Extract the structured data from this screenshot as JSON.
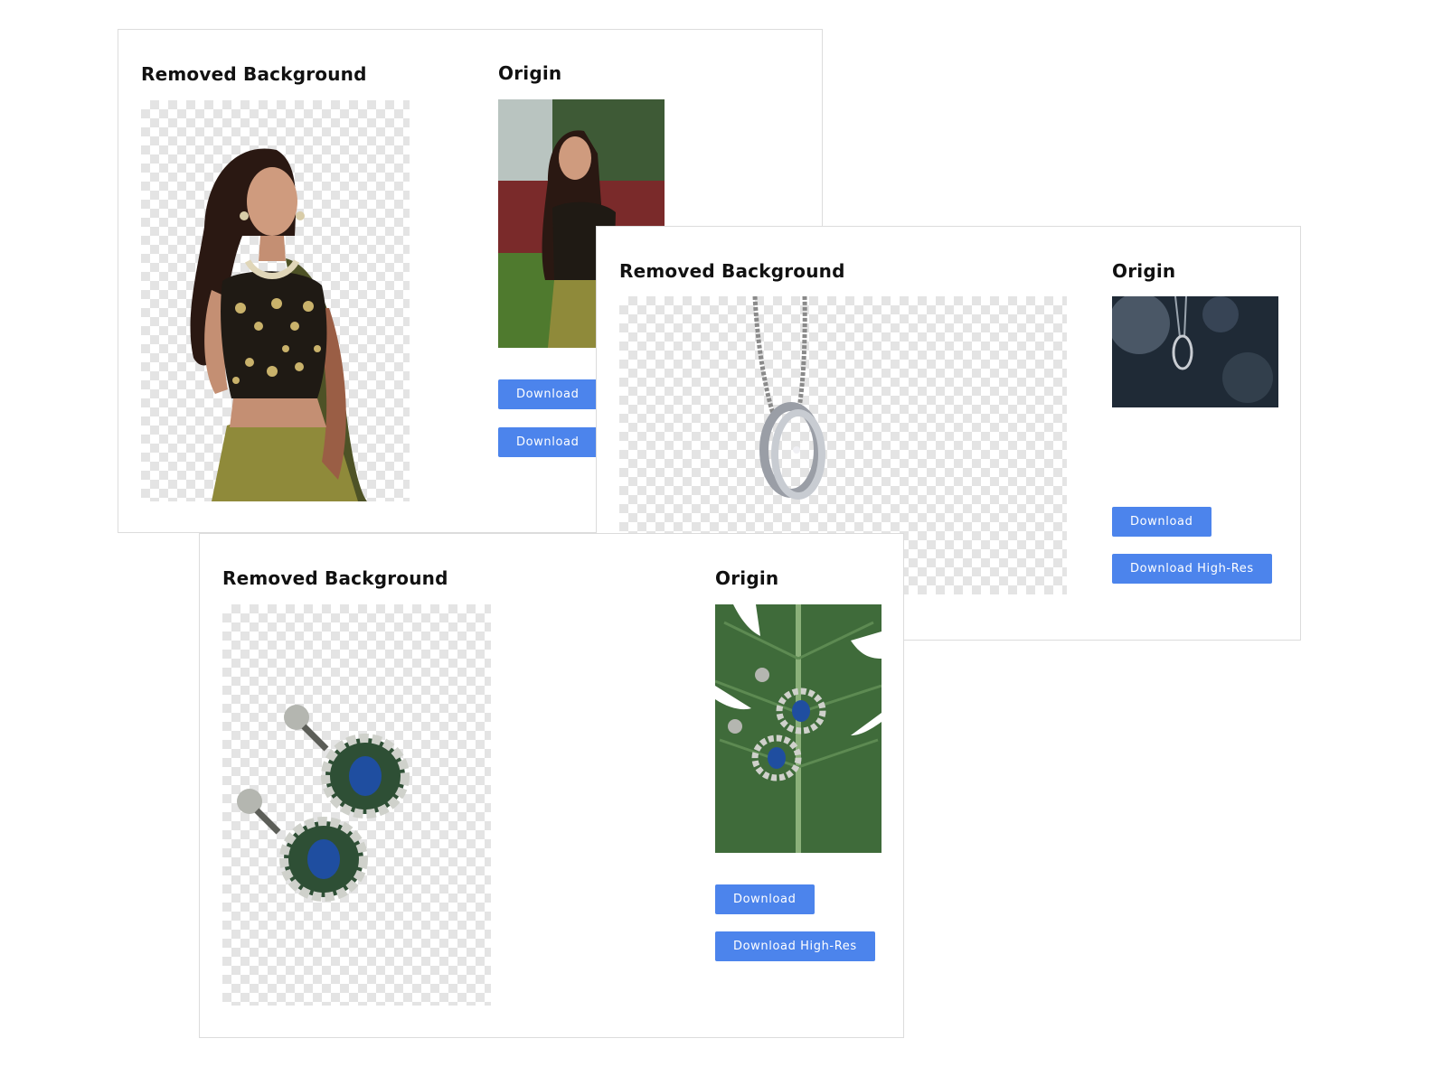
{
  "cards": [
    {
      "removed_title": "Removed Background",
      "origin_title": "Origin",
      "subject": "woman",
      "download_label": "Download",
      "download_hires_label": "Download"
    },
    {
      "removed_title": "Removed Background",
      "origin_title": "Origin",
      "subject": "ring-pendant",
      "download_label": "Download",
      "download_hires_label": "Download High-Res"
    },
    {
      "removed_title": "Removed Background",
      "origin_title": "Origin",
      "subject": "earrings",
      "download_label": "Download",
      "download_hires_label": "Download High-Res"
    }
  ],
  "colors": {
    "button": "#4c84ec",
    "checker": "#e4e4e4",
    "border": "#dcdcdc"
  }
}
